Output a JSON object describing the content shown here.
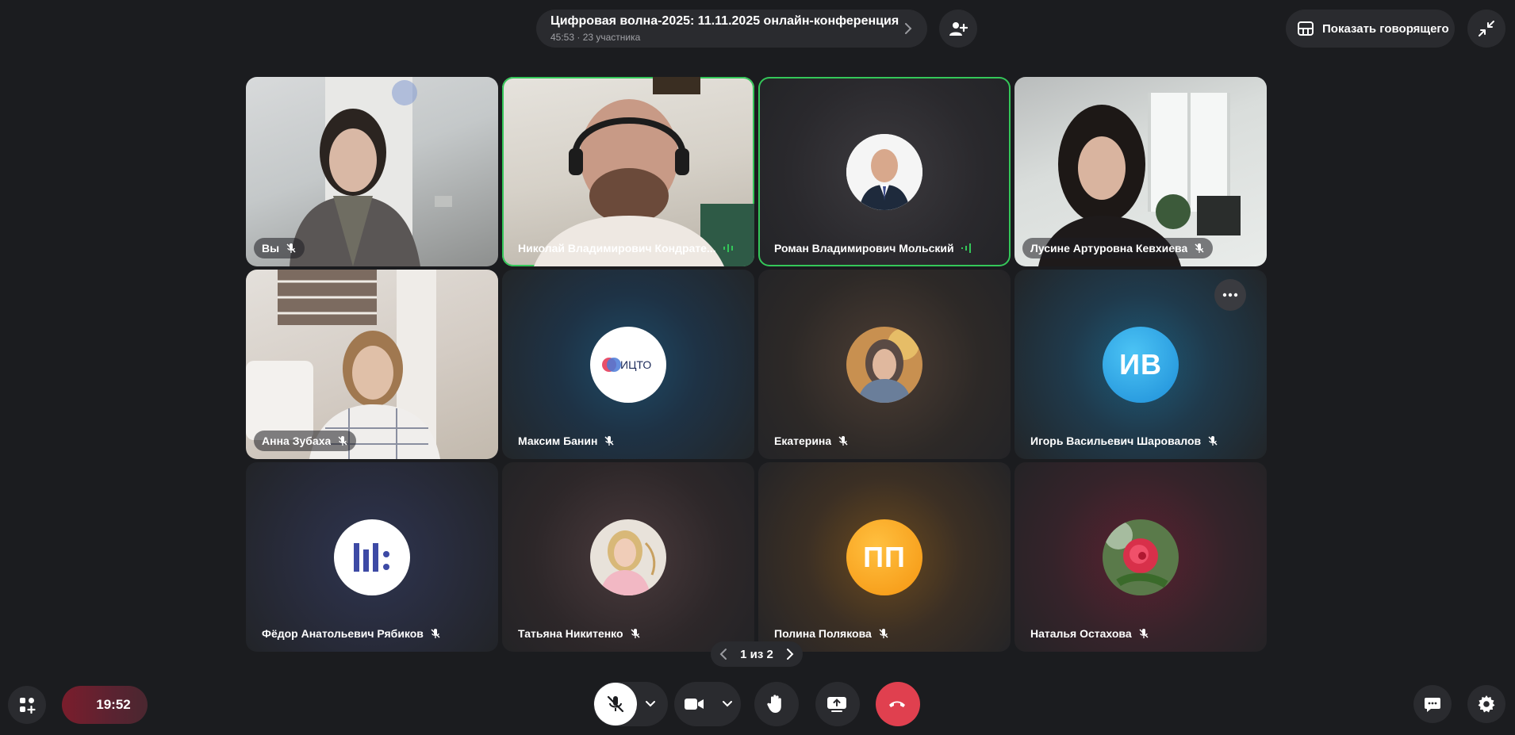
{
  "header": {
    "conference_title": "Цифровая волна-2025: 11.11.2025 онлайн-конференция",
    "conference_meta": "45:53 · 23 участника",
    "show_speaker_label": "Показать говорящего"
  },
  "tiles": [
    {
      "name": "Вы",
      "type": "video",
      "muted": true,
      "speaking": false
    },
    {
      "name": "Николай Владимирович Кондрате...",
      "type": "video",
      "muted": false,
      "speaking": true
    },
    {
      "name": "Роман Владимирович Мольский",
      "type": "avatar-photo",
      "muted": false,
      "speaking": true
    },
    {
      "name": "Лусине Артуровна Кевхиева",
      "type": "video",
      "muted": true,
      "speaking": false
    },
    {
      "name": "Анна Зубаха",
      "type": "video",
      "muted": true,
      "speaking": false
    },
    {
      "name": "Максим Банин",
      "type": "avatar-logo",
      "logo_text": "ИЦТО",
      "muted": true,
      "speaking": false
    },
    {
      "name": "Екатерина",
      "type": "avatar-photo",
      "muted": true,
      "speaking": false
    },
    {
      "name": "Игорь Васильевич Шаровалов",
      "type": "avatar-initials",
      "initials": "ИВ",
      "muted": true,
      "speaking": false
    },
    {
      "name": "Фёдор Анатольевич Рябиков",
      "type": "avatar-logo",
      "muted": true,
      "speaking": false
    },
    {
      "name": "Татьяна Никитенко",
      "type": "avatar-photo",
      "muted": true,
      "speaking": false
    },
    {
      "name": "Полина Полякова",
      "type": "avatar-initials",
      "initials": "ПП",
      "muted": true,
      "speaking": false
    },
    {
      "name": "Наталья Остахова",
      "type": "avatar-photo",
      "muted": true,
      "speaking": false
    }
  ],
  "pager": {
    "label": "1 из 2"
  },
  "timer": {
    "value": "19:52"
  },
  "colors": {
    "speaking_border": "#34c759",
    "end_call": "#e0404f",
    "initials_iv": "#2fa8f0",
    "initials_pp": "#f7a01a"
  },
  "icons": [
    "chevron-right-icon",
    "add-user-icon",
    "layout-icon",
    "collapse-icon",
    "mic-off-icon",
    "more-icon",
    "apps-icon",
    "camera-icon",
    "hand-icon",
    "screen-share-icon",
    "end-call-icon",
    "chat-icon",
    "settings-icon"
  ]
}
